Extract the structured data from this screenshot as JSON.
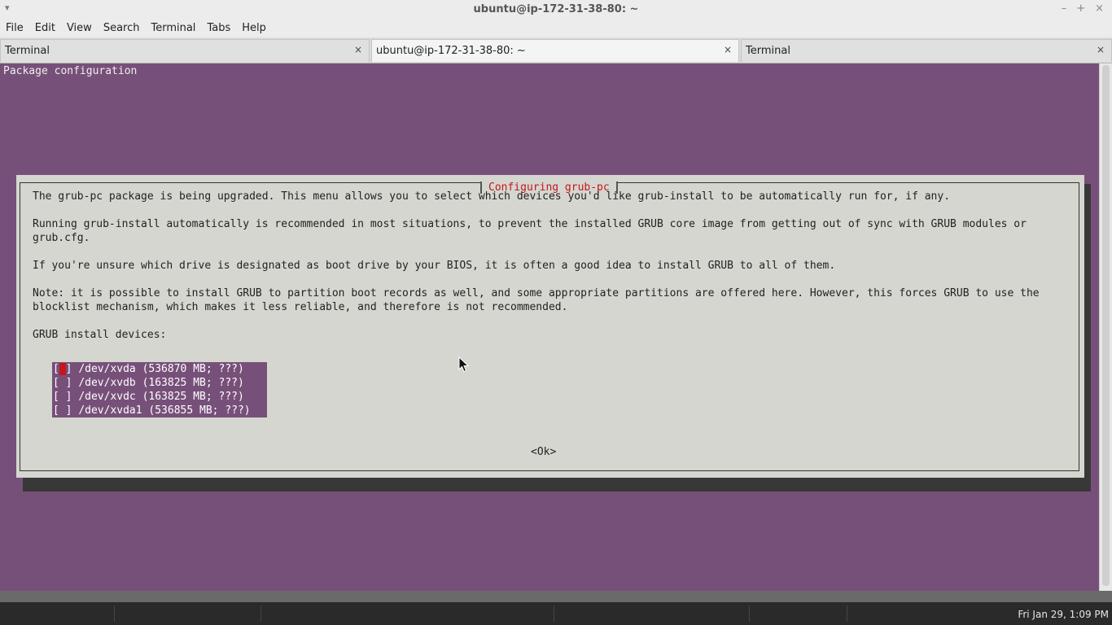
{
  "window": {
    "title": "ubuntu@ip-172-31-38-80: ~",
    "menu_arrow": "▾",
    "buttons": {
      "minimize": "–",
      "maximize": "+",
      "close": "×"
    }
  },
  "menubar": {
    "items": [
      "File",
      "Edit",
      "View",
      "Search",
      "Terminal",
      "Tabs",
      "Help"
    ]
  },
  "tabs": [
    {
      "label": "Terminal",
      "close": "×"
    },
    {
      "label": "ubuntu@ip-172-31-38-80: ~",
      "close": "×"
    },
    {
      "label": "Terminal",
      "close": "×"
    }
  ],
  "terminal": {
    "header": "Package configuration"
  },
  "dialog": {
    "title": "Configuring grub-pc",
    "paragraphs": [
      "The grub-pc package is being upgraded. This menu allows you to select which devices you'd like grub-install to be automatically run for, if any.",
      "Running grub-install automatically is recommended in most situations, to prevent the installed GRUB core image from getting out of sync with GRUB modules or\ngrub.cfg.",
      "If you're unsure which drive is designated as boot drive by your BIOS, it is often a good idea to install GRUB to all of them.",
      "Note: it is possible to install GRUB to partition boot records as well, and some appropriate partitions are offered here. However, this forces GRUB to use the\nblocklist mechanism, which makes it less reliable, and therefore is not recommended.",
      "GRUB install devices:"
    ],
    "devices": [
      {
        "checkbox_open": "[",
        "checkbox_mark": " ",
        "checkbox_close": "]",
        "label": "/dev/xvda (536870 MB; ???)"
      },
      {
        "checkbox_open": "[",
        "checkbox_mark": " ",
        "checkbox_close": "]",
        "label": "/dev/xvdb (163825 MB; ???)"
      },
      {
        "checkbox_open": "[",
        "checkbox_mark": " ",
        "checkbox_close": "]",
        "label": "/dev/xvdc (163825 MB; ???)"
      },
      {
        "checkbox_open": "[",
        "checkbox_mark": " ",
        "checkbox_close": "]",
        "label": "/dev/xvda1 (536855 MB; ???)"
      }
    ],
    "ok_label": "<Ok>"
  },
  "taskbar": {
    "clock": "Fri Jan 29, 1:09 PM"
  },
  "colors": {
    "terminal_bg": "#77507a",
    "dialog_bg": "#d5d6cf",
    "dialog_title": "#c4161c",
    "cursor": "#c4161c"
  }
}
